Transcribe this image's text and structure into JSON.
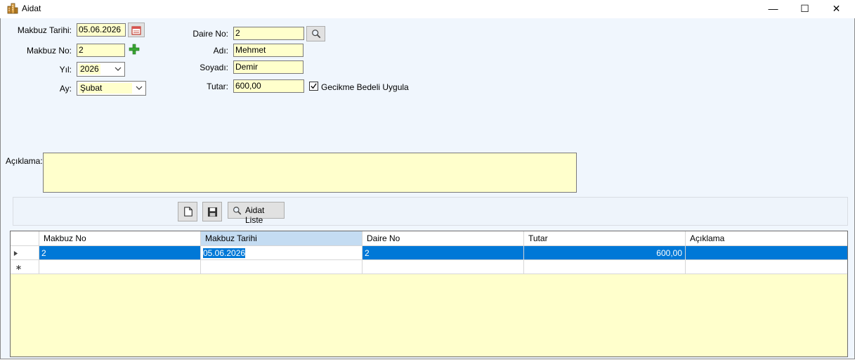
{
  "window": {
    "title": "Aidat",
    "minimize_glyph": "—",
    "maximize_glyph": "☐",
    "close_glyph": "✕"
  },
  "form": {
    "makbuz_tarihi_label": "Makbuz Tarihi:",
    "makbuz_tarihi_value": "05.06.2026",
    "makbuz_no_label": "Makbuz No:",
    "makbuz_no_value": "2",
    "yil_label": "Yıl:",
    "yil_value": "2026",
    "ay_label": "Ay:",
    "ay_value": "Şubat",
    "daire_no_label": "Daire No:",
    "daire_no_value": "2",
    "adi_label": "Adı:",
    "adi_value": "Mehmet",
    "soyadi_label": "Soyadı:",
    "soyadi_value": "Demir",
    "tutar_label": "Tutar:",
    "tutar_value": "600,00",
    "gecikme_label": "Gecikme Bedeli Uygula",
    "gecikme_checked": true,
    "aciklama_label": "Açıklama:",
    "aciklama_value": ""
  },
  "toolbar": {
    "aidat_liste_label": "Aidat Liste"
  },
  "grid": {
    "columns": [
      "Makbuz No",
      "Makbuz Tarihi",
      "Daire No",
      "Tutar",
      "Açıklama"
    ],
    "rows": [
      [
        "2",
        "05.06.2026",
        "2",
        "600,00",
        ""
      ]
    ]
  },
  "colors": {
    "input_bg": "#ffffcc",
    "selection": "#0078d7",
    "form_bg": "#f0f6fd"
  }
}
